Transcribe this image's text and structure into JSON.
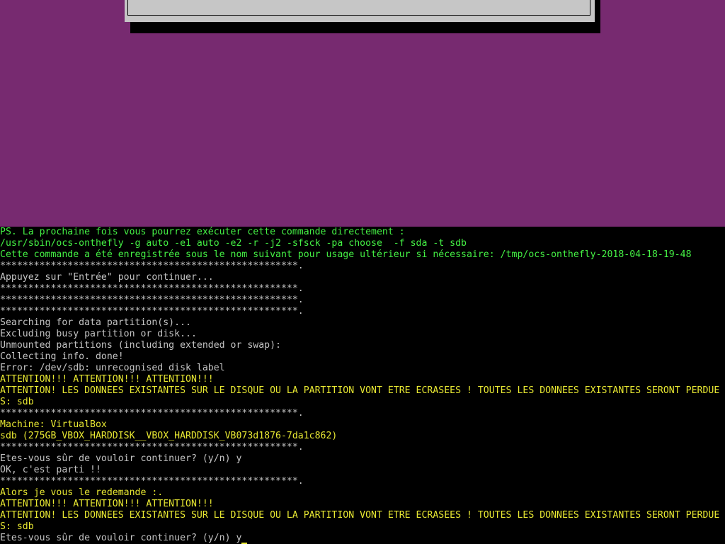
{
  "console": {
    "lines": [
      {
        "text": "PS. La prochaine fois vous pourrez exécuter cette commande directement :",
        "color": "green"
      },
      {
        "text": "/usr/sbin/ocs-onthefly -g auto -e1 auto -e2 -r -j2 -sfsck -pa choose  -f sda -t sdb",
        "color": "green"
      },
      {
        "text": "Cette commande a été enregistrée sous le nom suivant pour usage ultérieur si nécessaire: /tmp/ocs-onthefly-2018-04-18-19-48",
        "color": "green"
      },
      {
        "text": "*****************************************************.",
        "color": "white"
      },
      {
        "text": "Appuyez sur \"Entrée\" pour continuer...",
        "color": "white"
      },
      {
        "text": "*****************************************************.",
        "color": "white"
      },
      {
        "text": "*****************************************************.",
        "color": "white"
      },
      {
        "text": "*****************************************************.",
        "color": "white"
      },
      {
        "text": "Searching for data partition(s)...",
        "color": "white"
      },
      {
        "text": "Excluding busy partition or disk...",
        "color": "white"
      },
      {
        "text": "Unmounted partitions (including extended or swap):",
        "color": "white"
      },
      {
        "text": "Collecting info. done!",
        "color": "white"
      },
      {
        "text": "Error: /dev/sdb: unrecognised disk label",
        "color": "white"
      },
      {
        "text": "ATTENTION!!! ATTENTION!!! ATTENTION!!!",
        "color": "yellow"
      },
      {
        "text": "ATTENTION! LES DONNÉES EXISTANTES SUR LE DISQUE OU LA PARTITION VONT ÊTRE ÉCRASÉES ! TOUTES LES DONNÉES EXISTANTES SERONT PERDUE",
        "color": "yellow"
      },
      {
        "text": "S: sdb",
        "color": "yellow"
      },
      {
        "text": "*****************************************************.",
        "color": "white"
      },
      {
        "text": "Machine: VirtualBox",
        "color": "yellow"
      },
      {
        "text": "sdb (275GB_VBOX_HARDDISK__VBOX_HARDDISK_VB073d1876-7da1c862)",
        "color": "yellow"
      },
      {
        "text": "*****************************************************.",
        "color": "white"
      },
      {
        "text": "Etes-vous sûr de vouloir continuer? (y/n) y",
        "color": "white"
      },
      {
        "text": "OK, c'est parti !!",
        "color": "white"
      },
      {
        "text": "*****************************************************.",
        "color": "white"
      },
      {
        "text": "Alors je vous le redemande :.",
        "color": "yellow"
      },
      {
        "text": "ATTENTION!!! ATTENTION!!! ATTENTION!!!",
        "color": "yellow"
      },
      {
        "text": "ATTENTION! LES DONNÉES EXISTANTES SUR LE DISQUE OU LA PARTITION VONT ÊTRE ÉCRASÉES ! TOUTES LES DONNÉES EXISTANTES SERONT PERDUE",
        "color": "yellow"
      },
      {
        "text": "S: sdb",
        "color": "yellow"
      },
      {
        "text": "Etes-vous sûr de vouloir continuer? (y/n) y",
        "color": "white",
        "cursor": true
      }
    ]
  },
  "colors": {
    "background_upper": "#772a70",
    "console_background": "#000000",
    "text_white": "#c4c4c4",
    "text_green": "#44f044",
    "text_yellow": "#e8e832",
    "dialog_gray": "#c6c6c6"
  }
}
